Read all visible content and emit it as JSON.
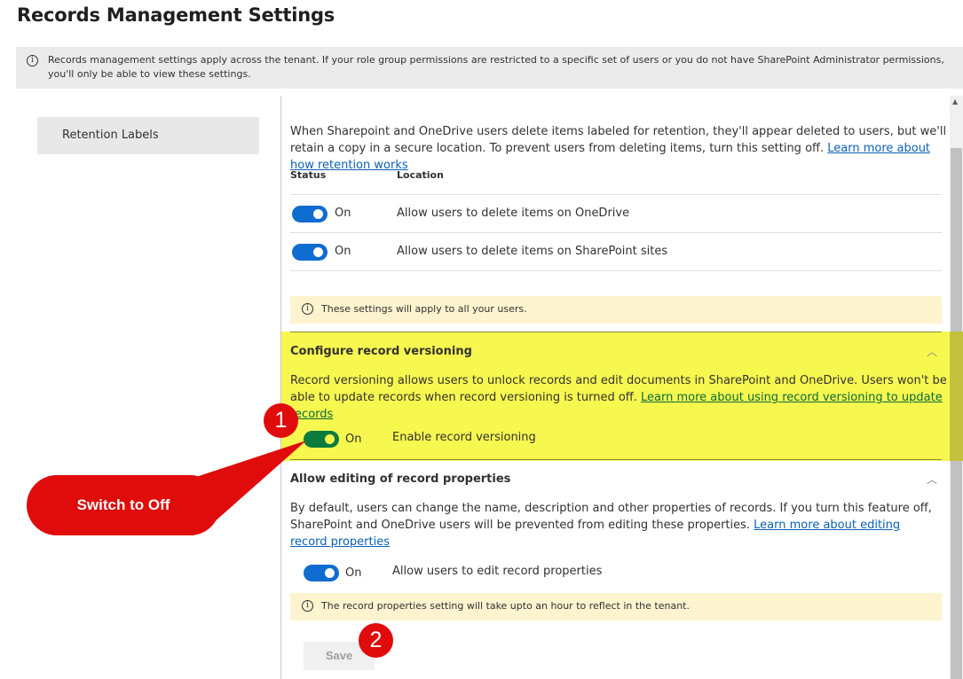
{
  "page": {
    "title": "Records Management Settings",
    "banner": {
      "icon": "info-icon",
      "text": "Records management settings apply across the tenant. If your role group permissions are restricted to a specific set of users or you do not have SharePoint Administrator permissions, you'll only be able to view these settings."
    }
  },
  "sidebar": {
    "items": [
      {
        "label": "Retention Labels",
        "selected": true
      }
    ]
  },
  "retention": {
    "description": "When Sharepoint and OneDrive users delete items labeled for retention, they'll appear deleted to users, but we'll retain a copy in a secure location. To prevent users from deleting items, turn this setting off. ",
    "link": "Learn more about how retention works",
    "columns": {
      "status": "Status",
      "location": "Location"
    },
    "rows": [
      {
        "state": "On",
        "enabled": true,
        "location": "Allow users to delete items on OneDrive"
      },
      {
        "state": "On",
        "enabled": true,
        "location": "Allow users to delete items on SharePoint sites"
      }
    ],
    "notice": "These settings will apply to all your users."
  },
  "versioning": {
    "title": "Configure record versioning",
    "description": "Record versioning allows users to unlock records and edit documents in SharePoint and OneDrive. Users won't be able to update records when record versioning is turned off. ",
    "link": "Learn more about using record versioning to update records",
    "toggle": {
      "state": "On",
      "enabled": true,
      "label": "Enable record versioning"
    },
    "highlight_color": "#f7f84f"
  },
  "properties": {
    "title": "Allow editing of record properties",
    "description": "By default, users can change the name, description and other properties of records. If you turn this feature off, SharePoint and OneDrive users will be prevented from editing these properties. ",
    "link": "Learn more about editing record properties",
    "toggle": {
      "state": "On",
      "enabled": true,
      "label": "Allow users to edit record properties"
    },
    "notice": "The record properties setting will take upto an hour to reflect in the tenant."
  },
  "actions": {
    "save_label": "Save",
    "save_disabled": true
  },
  "annotations": {
    "callout_text": "Switch to Off",
    "badge_1": "1",
    "badge_2": "2",
    "color": "#e00b0b"
  },
  "icons": {
    "info": "ⓘ",
    "chevron_up": "︿",
    "scroll_up": "▲"
  }
}
